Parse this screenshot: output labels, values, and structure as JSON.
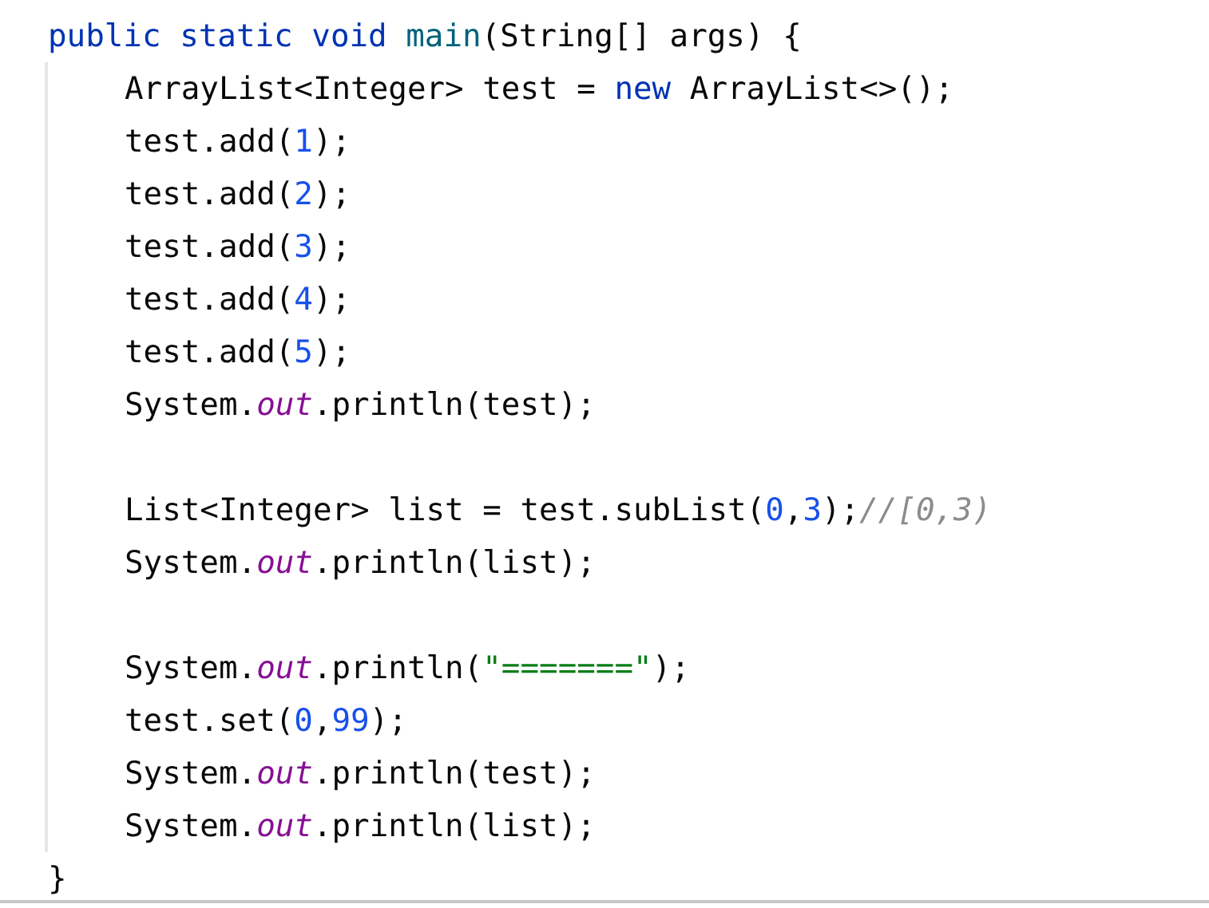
{
  "method": {
    "signature": [
      {
        "kind": "keyword",
        "text": "public static void "
      },
      {
        "kind": "method",
        "text": "main"
      },
      {
        "kind": "plain",
        "text": "(String[] args) {"
      }
    ],
    "body": [
      {
        "kind": "code",
        "tokens": [
          {
            "kind": "plain",
            "text": "ArrayList<Integer> test = "
          },
          {
            "kind": "keyword",
            "text": "new"
          },
          {
            "kind": "plain",
            "text": " ArrayList<>();"
          }
        ]
      },
      {
        "kind": "code",
        "tokens": [
          {
            "kind": "plain",
            "text": "test.add("
          },
          {
            "kind": "number",
            "text": "1"
          },
          {
            "kind": "plain",
            "text": ");"
          }
        ]
      },
      {
        "kind": "code",
        "tokens": [
          {
            "kind": "plain",
            "text": "test.add("
          },
          {
            "kind": "number",
            "text": "2"
          },
          {
            "kind": "plain",
            "text": ");"
          }
        ]
      },
      {
        "kind": "code",
        "tokens": [
          {
            "kind": "plain",
            "text": "test.add("
          },
          {
            "kind": "number",
            "text": "3"
          },
          {
            "kind": "plain",
            "text": ");"
          }
        ]
      },
      {
        "kind": "code",
        "tokens": [
          {
            "kind": "plain",
            "text": "test.add("
          },
          {
            "kind": "number",
            "text": "4"
          },
          {
            "kind": "plain",
            "text": ");"
          }
        ]
      },
      {
        "kind": "code",
        "tokens": [
          {
            "kind": "plain",
            "text": "test.add("
          },
          {
            "kind": "number",
            "text": "5"
          },
          {
            "kind": "plain",
            "text": ");"
          }
        ]
      },
      {
        "kind": "code",
        "tokens": [
          {
            "kind": "plain",
            "text": "System."
          },
          {
            "kind": "field",
            "text": "out"
          },
          {
            "kind": "plain",
            "text": ".println(test);"
          }
        ]
      },
      {
        "kind": "blank"
      },
      {
        "kind": "code",
        "tokens": [
          {
            "kind": "plain",
            "text": "List<Integer> list = test.subList("
          },
          {
            "kind": "number",
            "text": "0"
          },
          {
            "kind": "plain",
            "text": ","
          },
          {
            "kind": "number",
            "text": "3"
          },
          {
            "kind": "plain",
            "text": ");"
          },
          {
            "kind": "comment",
            "text": "//[0,3)"
          }
        ]
      },
      {
        "kind": "code",
        "tokens": [
          {
            "kind": "plain",
            "text": "System."
          },
          {
            "kind": "field",
            "text": "out"
          },
          {
            "kind": "plain",
            "text": ".println(list);"
          }
        ]
      },
      {
        "kind": "blank"
      },
      {
        "kind": "code",
        "tokens": [
          {
            "kind": "plain",
            "text": "System."
          },
          {
            "kind": "field",
            "text": "out"
          },
          {
            "kind": "plain",
            "text": ".println("
          },
          {
            "kind": "string",
            "text": "\"=======\""
          },
          {
            "kind": "plain",
            "text": ");"
          }
        ]
      },
      {
        "kind": "code",
        "tokens": [
          {
            "kind": "plain",
            "text": "test.set("
          },
          {
            "kind": "number",
            "text": "0"
          },
          {
            "kind": "plain",
            "text": ","
          },
          {
            "kind": "number",
            "text": "99"
          },
          {
            "kind": "plain",
            "text": ");"
          }
        ]
      },
      {
        "kind": "code",
        "tokens": [
          {
            "kind": "plain",
            "text": "System."
          },
          {
            "kind": "field",
            "text": "out"
          },
          {
            "kind": "plain",
            "text": ".println(test);"
          }
        ]
      },
      {
        "kind": "code",
        "tokens": [
          {
            "kind": "plain",
            "text": "System."
          },
          {
            "kind": "field",
            "text": "out"
          },
          {
            "kind": "plain",
            "text": ".println(list);"
          }
        ]
      }
    ],
    "closing": "}"
  }
}
